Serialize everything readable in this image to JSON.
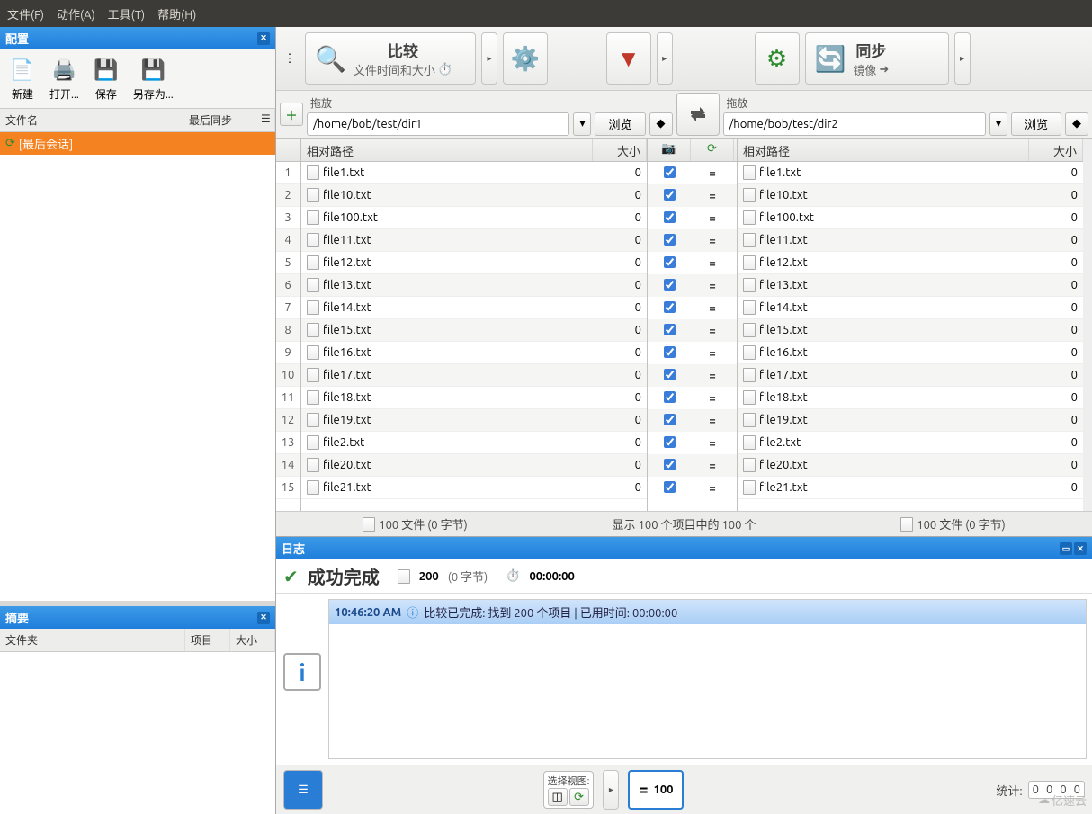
{
  "menu": {
    "file": "文件(F)",
    "action": "动作(A)",
    "tools": "工具(T)",
    "help": "帮助(H)"
  },
  "config": {
    "title": "配置",
    "new": "新建",
    "open": "打开...",
    "save": "保存",
    "saveas": "另存为...",
    "col_name": "文件名",
    "col_sync": "最后同步",
    "session": "[最后会话]"
  },
  "summary": {
    "title": "摘要",
    "col_folder": "文件夹",
    "col_items": "项目",
    "col_size": "大小"
  },
  "toolbar": {
    "compare": "比较",
    "compare_sub": "文件时间和大小",
    "sync": "同步",
    "sync_sub": "镜像"
  },
  "paths": {
    "drag": "拖放",
    "browse": "浏览",
    "left": "/home/bob/test/dir1",
    "right": "/home/bob/test/dir2"
  },
  "cols": {
    "relpath": "相对路径",
    "size": "大小"
  },
  "files": [
    {
      "name": "file1.txt",
      "size": 0
    },
    {
      "name": "file10.txt",
      "size": 0
    },
    {
      "name": "file100.txt",
      "size": 0
    },
    {
      "name": "file11.txt",
      "size": 0
    },
    {
      "name": "file12.txt",
      "size": 0
    },
    {
      "name": "file13.txt",
      "size": 0
    },
    {
      "name": "file14.txt",
      "size": 0
    },
    {
      "name": "file15.txt",
      "size": 0
    },
    {
      "name": "file16.txt",
      "size": 0
    },
    {
      "name": "file17.txt",
      "size": 0
    },
    {
      "name": "file18.txt",
      "size": 0
    },
    {
      "name": "file19.txt",
      "size": 0
    },
    {
      "name": "file2.txt",
      "size": 0
    },
    {
      "name": "file20.txt",
      "size": 0
    },
    {
      "name": "file21.txt",
      "size": 0
    }
  ],
  "status": {
    "left_count": "100 文件  (0 字节)",
    "center": "显示 100 个项目中的 100 个",
    "right_count": "100 文件  (0 字节)"
  },
  "log": {
    "title": "日志",
    "result": "成功完成",
    "count": "200",
    "count_bytes": "(0 字节)",
    "elapsed": "00:00:00",
    "msg_time": "10:46:20 AM",
    "msg": "比较已完成: 找到 200 个项目 | 已用时间: 00:00:00"
  },
  "bottom": {
    "view_label": "选择视图:",
    "count": "100",
    "stats_label": "统计:",
    "stats": [
      "0",
      "0",
      "0",
      "0"
    ]
  },
  "watermark": "亿速云"
}
